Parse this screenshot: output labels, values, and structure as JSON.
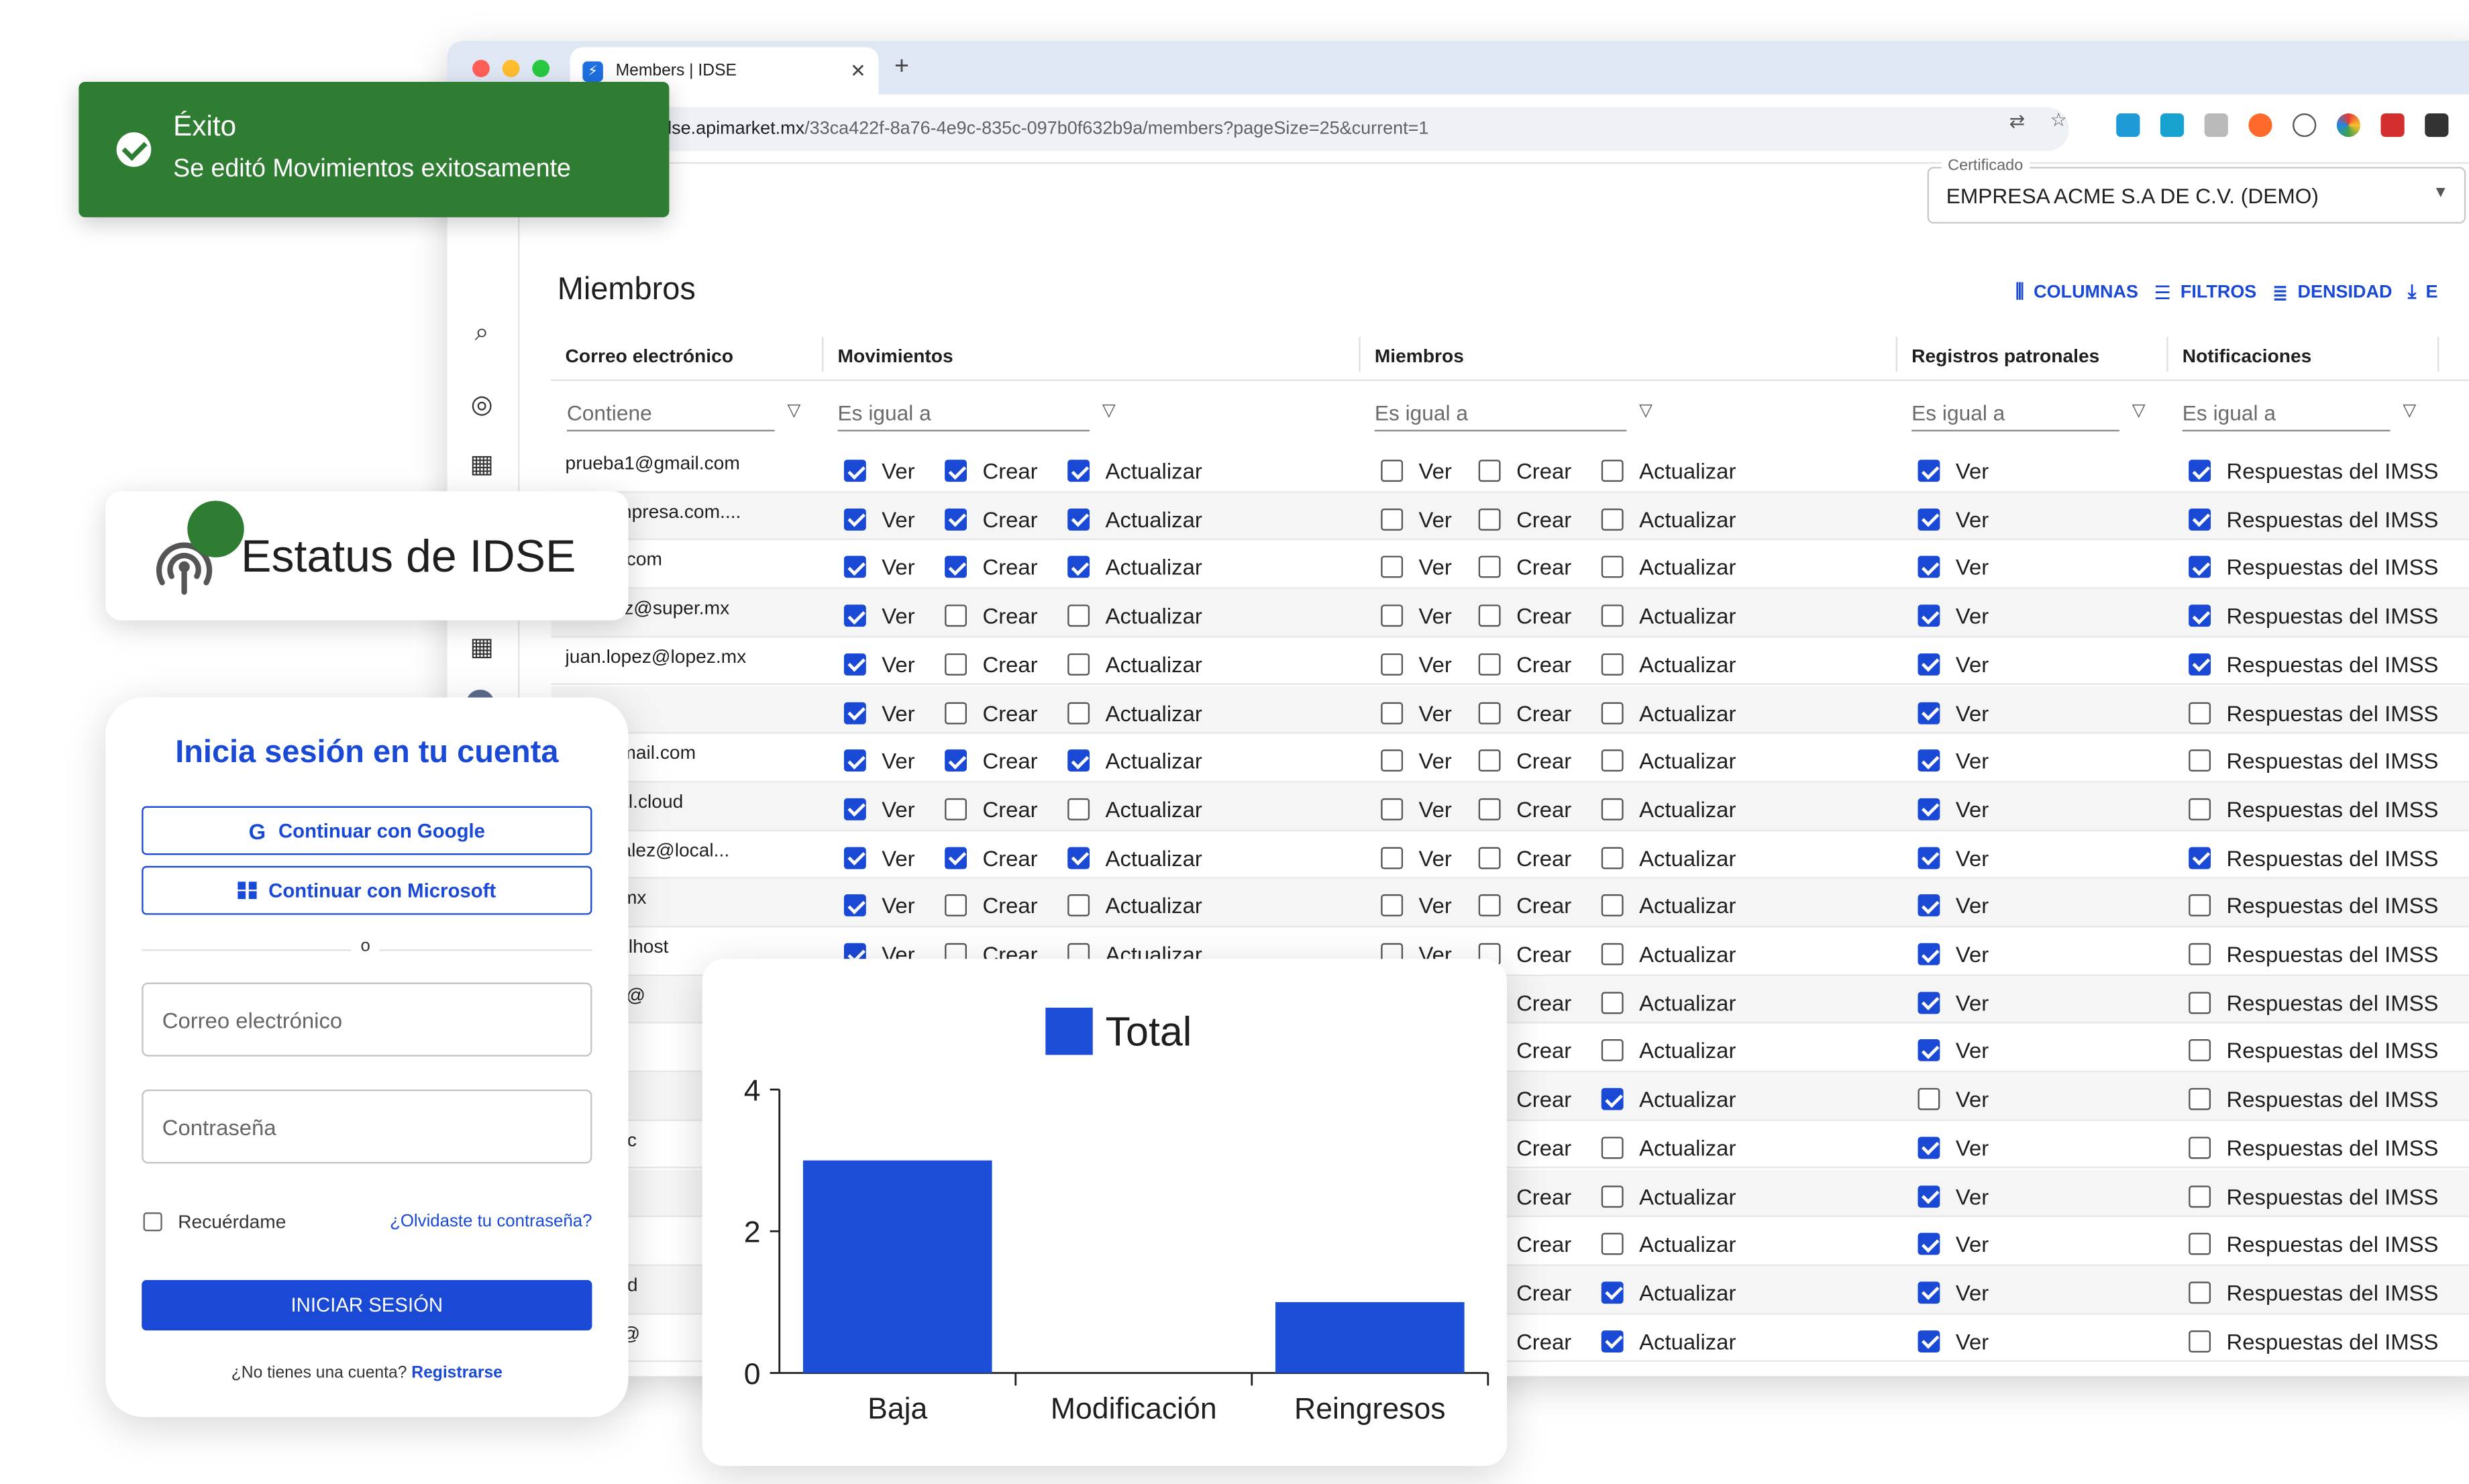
{
  "browser": {
    "tab_title": "Members | IDSE",
    "url_prefix": "lse.apimarket.mx",
    "url_path": "/33ca422f-8a76-4e9c-835c-097b0f632b9a/members?pageSize=25&current=1"
  },
  "certificate": {
    "label": "Certificado",
    "value": "EMPRESA ACME S.A DE C.V. (DEMO)"
  },
  "page": {
    "title": "Miembros"
  },
  "toolbar": {
    "columns": "COLUMNAS",
    "filters": "FILTROS",
    "density": "DENSIDAD",
    "export": "E"
  },
  "columns": [
    "Correo electrónico",
    "Movimientos",
    "Miembros",
    "Registros patronales",
    "Notificaciones"
  ],
  "filters": {
    "email": "Contiene",
    "movimientos": "Es igual a",
    "miembros": "Es igual a",
    "registros": "Es igual a",
    "notificaciones": "Es igual a"
  },
  "labels": {
    "ver": "Ver",
    "crear": "Crear",
    "actualizar": "Actualizar",
    "respuestas": "Respuestas del IMSS"
  },
  "rows": [
    {
      "email": "prueba1@gmail.com",
      "mov": [
        1,
        1,
        1
      ],
      "mie": [
        0,
        0,
        0
      ],
      "reg": 1,
      "not": 1
    },
    {
      "email": "a2@empresa.com....",
      "mov": [
        1,
        1,
        1
      ],
      "mie": [
        0,
        0,
        0
      ],
      "reg": 1,
      "not": 1
    },
    {
      "email": "@uber.com",
      "mov": [
        1,
        1,
        1
      ],
      "mie": [
        0,
        0,
        0
      ],
      "reg": 1,
      "not": 1
    },
    {
      "email": "ordunez@super.mx",
      "mov": [
        1,
        0,
        0
      ],
      "mie": [
        0,
        0,
        0
      ],
      "reg": 1,
      "not": 1
    },
    {
      "email": "juan.lopez@lopez.mx",
      "mov": [
        1,
        0,
        0
      ],
      "mie": [
        0,
        0,
        0
      ],
      "reg": 1,
      "not": 1
    },
    {
      "email": "",
      "mov": [
        1,
        0,
        0
      ],
      "mie": [
        0,
        0,
        0
      ],
      "reg": 1,
      "not": 0
    },
    {
      "email": "pi0@gmail.com",
      "mov": [
        1,
        1,
        1
      ],
      "mie": [
        0,
        0,
        0
      ],
      "reg": 1,
      "not": 0
    },
    {
      "email": "s@local.cloud",
      "mov": [
        1,
        0,
        0
      ],
      "mie": [
        0,
        0,
        0
      ],
      "reg": 1,
      "not": 0
    },
    {
      "email": "s.gonzalez@local...",
      "mov": [
        1,
        1,
        1
      ],
      "mie": [
        0,
        0,
        0
      ],
      "reg": 1,
      "not": 1
    },
    {
      "email": "@gob.mx",
      "mov": [
        1,
        0,
        0
      ],
      "mie": [
        0,
        0,
        0
      ],
      "reg": 1,
      "not": 0
    },
    {
      "email": "s@localhost",
      "mov": [
        1,
        0,
        0
      ],
      "mie": [
        0,
        0,
        0
      ],
      "reg": 1,
      "not": 0
    },
    {
      "email": "a.lopez@",
      "mov": [
        0,
        0,
        0
      ],
      "mie": [
        0,
        0,
        0
      ],
      "reg": 1,
      "not": 0
    },
    {
      "email": "",
      "mov": [
        0,
        0,
        0
      ],
      "mie": [
        0,
        0,
        0
      ],
      "reg": 1,
      "not": 0
    },
    {
      "email": "",
      "mov": [
        0,
        0,
        0
      ],
      "mie": [
        0,
        0,
        1
      ],
      "reg": 0,
      "not": 0
    },
    {
      "email": "google.c",
      "mov": [
        0,
        0,
        0
      ],
      "mie": [
        0,
        0,
        0
      ],
      "reg": 1,
      "not": 0
    },
    {
      "email": "",
      "mov": [
        0,
        0,
        0
      ],
      "mie": [
        0,
        0,
        0
      ],
      "reg": 1,
      "not": 0
    },
    {
      "email": "",
      "mov": [
        0,
        0,
        0
      ],
      "mie": [
        0,
        0,
        0
      ],
      "reg": 1,
      "not": 0
    },
    {
      "email": "Hernand",
      "mov": [
        0,
        0,
        0
      ],
      "mie": [
        0,
        0,
        1
      ],
      "reg": 1,
      "not": 0
    },
    {
      "email": "ket.mx@",
      "mov": [
        0,
        0,
        0
      ],
      "mie": [
        0,
        0,
        1
      ],
      "reg": 1,
      "not": 0
    }
  ],
  "toast": {
    "title": "Éxito",
    "message": "Se editó Movimientos exitosamente",
    "color": "#2e7d32"
  },
  "status": {
    "title": "Estatus de IDSE",
    "indicator_color": "#2e7d32"
  },
  "login": {
    "title": "Inicia sesión en tu cuenta",
    "google": "Continuar con Google",
    "microsoft": "Continuar con Microsoft",
    "or": "o",
    "email_placeholder": "Correo electrónico",
    "password_placeholder": "Contraseña",
    "remember": "Recuérdame",
    "forgot": "¿Olvidaste tu contraseña?",
    "submit": "INICIAR SESIÓN",
    "no_account": "¿No tienes una cuenta?",
    "register": "Registrarse"
  },
  "accent_color": "#1a49d6",
  "chart_data": {
    "type": "bar",
    "categories": [
      "Baja",
      "Modificación",
      "Reingresos"
    ],
    "series": [
      {
        "name": "Total",
        "values": [
          3,
          0,
          1
        ],
        "color": "#1d4ed8"
      }
    ],
    "ylim": [
      0,
      4
    ],
    "yticks": [
      0,
      2,
      4
    ],
    "legend": "top-center",
    "grid": false
  }
}
